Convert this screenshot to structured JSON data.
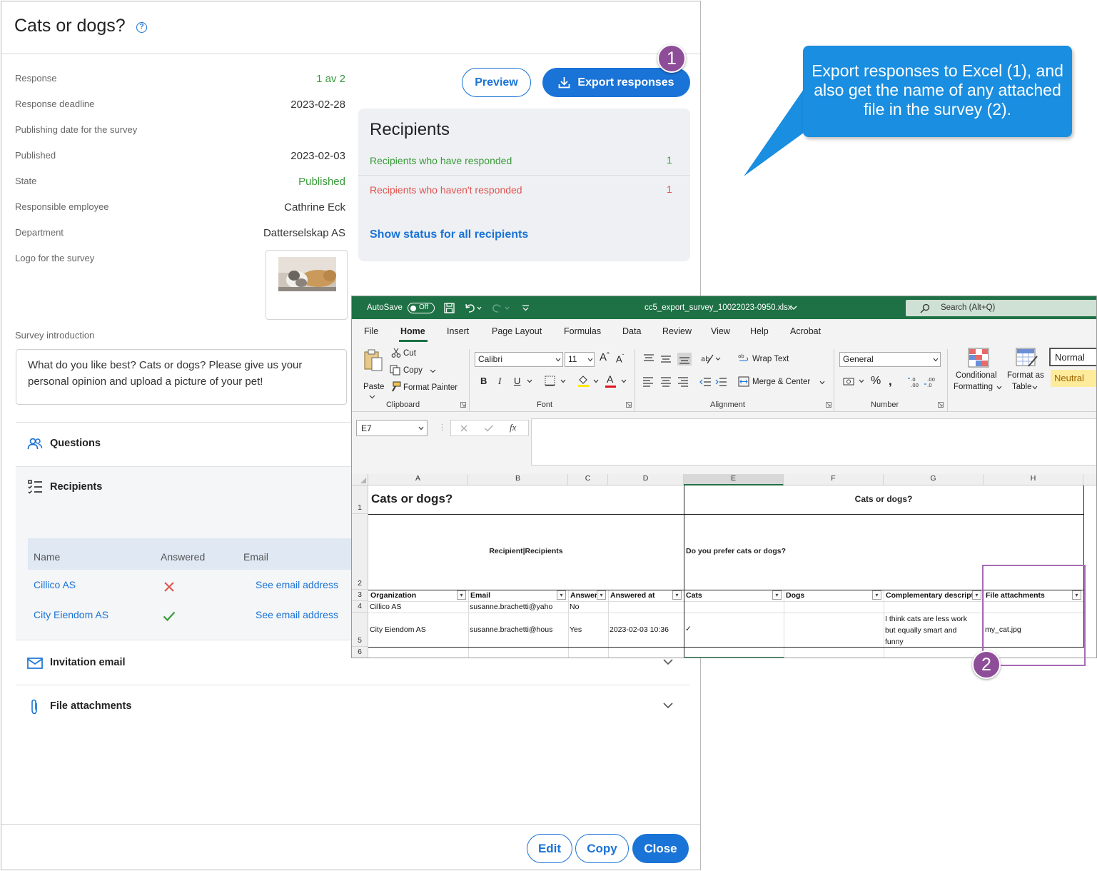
{
  "panel": {
    "title": "Cats or dogs?",
    "properties": [
      {
        "label": "Response",
        "value": "1 av 2"
      },
      {
        "label": "Response deadline",
        "value": "2023-02-28"
      },
      {
        "label": "Publishing date for the survey",
        "value": ""
      },
      {
        "label": "Published",
        "value": "2023-02-03"
      },
      {
        "label": "State",
        "value": "Published"
      },
      {
        "label": "Responsible employee",
        "value": "Cathrine Eck"
      },
      {
        "label": "Department",
        "value": "Datterselskap AS"
      },
      {
        "label": "Logo for the survey",
        "value": ""
      }
    ],
    "intro_label": "Survey introduction",
    "intro_text": "What do you like best? Cats or dogs? Please give us your personal opinion and upload a picture of your pet!",
    "sections": {
      "questions": "Questions",
      "recipients": "Recipients",
      "invitation": "Invitation email",
      "attachments": "File attachments"
    },
    "table": {
      "headers": [
        "Name",
        "Answered",
        "Email"
      ],
      "rows": [
        {
          "name": "Cillico AS",
          "answered": "no",
          "email": "See email address"
        },
        {
          "name": "City Eiendom AS",
          "answered": "yes",
          "email": "See email address"
        }
      ]
    },
    "buttons": {
      "preview": "Preview",
      "export": "Export responses",
      "edit": "Edit",
      "copy": "Copy",
      "close": "Close"
    },
    "recipients_card": {
      "title": "Recipients",
      "responded_label": "Recipients who have responded",
      "responded_count": "1",
      "not_responded_label": "Recipients who haven't responded",
      "not_responded_count": "1",
      "show_status": "Show status for all recipients"
    },
    "colors": {
      "accent": "#1a73d6",
      "green": "#3a9b3a",
      "red": "#e0534f"
    }
  },
  "callout": {
    "text": "Export responses to Excel (1), and also get the name of any attached file in the survey (2).",
    "badge1": "1",
    "badge2": "2",
    "badge_color": "#8e4d99"
  },
  "excel": {
    "autosave": "AutoSave",
    "autosave_state": "Off",
    "filename": "cc5_export_survey_10022023-0950.xlsx",
    "search": "Search (Alt+Q)",
    "menu": [
      "File",
      "Home",
      "Insert",
      "Page Layout",
      "Formulas",
      "Data",
      "Review",
      "View",
      "Help",
      "Acrobat"
    ],
    "clipboard": {
      "paste": "Paste",
      "cut": "Cut",
      "copy": "Copy",
      "format_painter": "Format Painter",
      "label": "Clipboard"
    },
    "font": {
      "name": "Calibri",
      "size": "11",
      "label": "Font"
    },
    "alignment": {
      "wrap": "Wrap Text",
      "merge": "Merge & Center",
      "label": "Alignment"
    },
    "number": {
      "format": "General",
      "label": "Number"
    },
    "styles": {
      "conditional_1": "Conditional",
      "conditional_2": "Formatting",
      "format_as_1": "Format as",
      "format_as_2": "Table",
      "normal": "Normal",
      "neutral": "Neutral"
    },
    "name_box": "E7",
    "fx": "fx",
    "col_headers": [
      "A",
      "B",
      "C",
      "D",
      "E",
      "F",
      "G",
      "H"
    ],
    "row_headers": [
      "1",
      "2",
      "3",
      "4",
      "5",
      "6"
    ],
    "sheet": {
      "title_left": "Cats or dogs?",
      "title_right": "Cats or dogs?",
      "group_left": "Recipient|Recipients",
      "group_right": "Do you prefer cats or dogs?",
      "headers": [
        "Organization",
        "Email",
        "Answer",
        "Answered at",
        "Cats",
        "Dogs",
        "Complementary descript",
        "File attachments"
      ],
      "row4": [
        "Cillico AS",
        "susanne.brachetti@yaho",
        "No",
        "",
        "",
        "",
        "",
        ""
      ],
      "row5": [
        "City Eiendom AS",
        "susanne.brachetti@hous",
        "Yes",
        "2023-02-03 10:36",
        "✓",
        "",
        "I think cats are less work but equally smart and funny",
        "my_cat.jpg"
      ]
    }
  }
}
